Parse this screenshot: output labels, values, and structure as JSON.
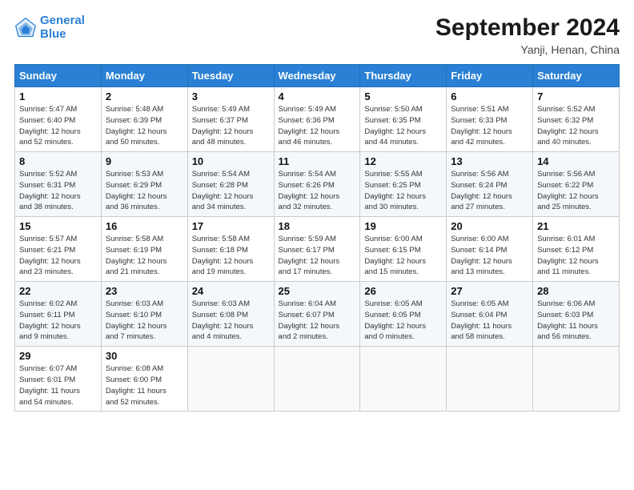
{
  "header": {
    "logo_line1": "General",
    "logo_line2": "Blue",
    "month_title": "September 2024",
    "location": "Yanji, Henan, China"
  },
  "days_of_week": [
    "Sunday",
    "Monday",
    "Tuesday",
    "Wednesday",
    "Thursday",
    "Friday",
    "Saturday"
  ],
  "weeks": [
    [
      {
        "day": "1",
        "info": "Sunrise: 5:47 AM\nSunset: 6:40 PM\nDaylight: 12 hours\nand 52 minutes."
      },
      {
        "day": "2",
        "info": "Sunrise: 5:48 AM\nSunset: 6:39 PM\nDaylight: 12 hours\nand 50 minutes."
      },
      {
        "day": "3",
        "info": "Sunrise: 5:49 AM\nSunset: 6:37 PM\nDaylight: 12 hours\nand 48 minutes."
      },
      {
        "day": "4",
        "info": "Sunrise: 5:49 AM\nSunset: 6:36 PM\nDaylight: 12 hours\nand 46 minutes."
      },
      {
        "day": "5",
        "info": "Sunrise: 5:50 AM\nSunset: 6:35 PM\nDaylight: 12 hours\nand 44 minutes."
      },
      {
        "day": "6",
        "info": "Sunrise: 5:51 AM\nSunset: 6:33 PM\nDaylight: 12 hours\nand 42 minutes."
      },
      {
        "day": "7",
        "info": "Sunrise: 5:52 AM\nSunset: 6:32 PM\nDaylight: 12 hours\nand 40 minutes."
      }
    ],
    [
      {
        "day": "8",
        "info": "Sunrise: 5:52 AM\nSunset: 6:31 PM\nDaylight: 12 hours\nand 38 minutes."
      },
      {
        "day": "9",
        "info": "Sunrise: 5:53 AM\nSunset: 6:29 PM\nDaylight: 12 hours\nand 36 minutes."
      },
      {
        "day": "10",
        "info": "Sunrise: 5:54 AM\nSunset: 6:28 PM\nDaylight: 12 hours\nand 34 minutes."
      },
      {
        "day": "11",
        "info": "Sunrise: 5:54 AM\nSunset: 6:26 PM\nDaylight: 12 hours\nand 32 minutes."
      },
      {
        "day": "12",
        "info": "Sunrise: 5:55 AM\nSunset: 6:25 PM\nDaylight: 12 hours\nand 30 minutes."
      },
      {
        "day": "13",
        "info": "Sunrise: 5:56 AM\nSunset: 6:24 PM\nDaylight: 12 hours\nand 27 minutes."
      },
      {
        "day": "14",
        "info": "Sunrise: 5:56 AM\nSunset: 6:22 PM\nDaylight: 12 hours\nand 25 minutes."
      }
    ],
    [
      {
        "day": "15",
        "info": "Sunrise: 5:57 AM\nSunset: 6:21 PM\nDaylight: 12 hours\nand 23 minutes."
      },
      {
        "day": "16",
        "info": "Sunrise: 5:58 AM\nSunset: 6:19 PM\nDaylight: 12 hours\nand 21 minutes."
      },
      {
        "day": "17",
        "info": "Sunrise: 5:58 AM\nSunset: 6:18 PM\nDaylight: 12 hours\nand 19 minutes."
      },
      {
        "day": "18",
        "info": "Sunrise: 5:59 AM\nSunset: 6:17 PM\nDaylight: 12 hours\nand 17 minutes."
      },
      {
        "day": "19",
        "info": "Sunrise: 6:00 AM\nSunset: 6:15 PM\nDaylight: 12 hours\nand 15 minutes."
      },
      {
        "day": "20",
        "info": "Sunrise: 6:00 AM\nSunset: 6:14 PM\nDaylight: 12 hours\nand 13 minutes."
      },
      {
        "day": "21",
        "info": "Sunrise: 6:01 AM\nSunset: 6:12 PM\nDaylight: 12 hours\nand 11 minutes."
      }
    ],
    [
      {
        "day": "22",
        "info": "Sunrise: 6:02 AM\nSunset: 6:11 PM\nDaylight: 12 hours\nand 9 minutes."
      },
      {
        "day": "23",
        "info": "Sunrise: 6:03 AM\nSunset: 6:10 PM\nDaylight: 12 hours\nand 7 minutes."
      },
      {
        "day": "24",
        "info": "Sunrise: 6:03 AM\nSunset: 6:08 PM\nDaylight: 12 hours\nand 4 minutes."
      },
      {
        "day": "25",
        "info": "Sunrise: 6:04 AM\nSunset: 6:07 PM\nDaylight: 12 hours\nand 2 minutes."
      },
      {
        "day": "26",
        "info": "Sunrise: 6:05 AM\nSunset: 6:05 PM\nDaylight: 12 hours\nand 0 minutes."
      },
      {
        "day": "27",
        "info": "Sunrise: 6:05 AM\nSunset: 6:04 PM\nDaylight: 11 hours\nand 58 minutes."
      },
      {
        "day": "28",
        "info": "Sunrise: 6:06 AM\nSunset: 6:03 PM\nDaylight: 11 hours\nand 56 minutes."
      }
    ],
    [
      {
        "day": "29",
        "info": "Sunrise: 6:07 AM\nSunset: 6:01 PM\nDaylight: 11 hours\nand 54 minutes."
      },
      {
        "day": "30",
        "info": "Sunrise: 6:08 AM\nSunset: 6:00 PM\nDaylight: 11 hours\nand 52 minutes."
      },
      {
        "day": "",
        "info": ""
      },
      {
        "day": "",
        "info": ""
      },
      {
        "day": "",
        "info": ""
      },
      {
        "day": "",
        "info": ""
      },
      {
        "day": "",
        "info": ""
      }
    ]
  ]
}
